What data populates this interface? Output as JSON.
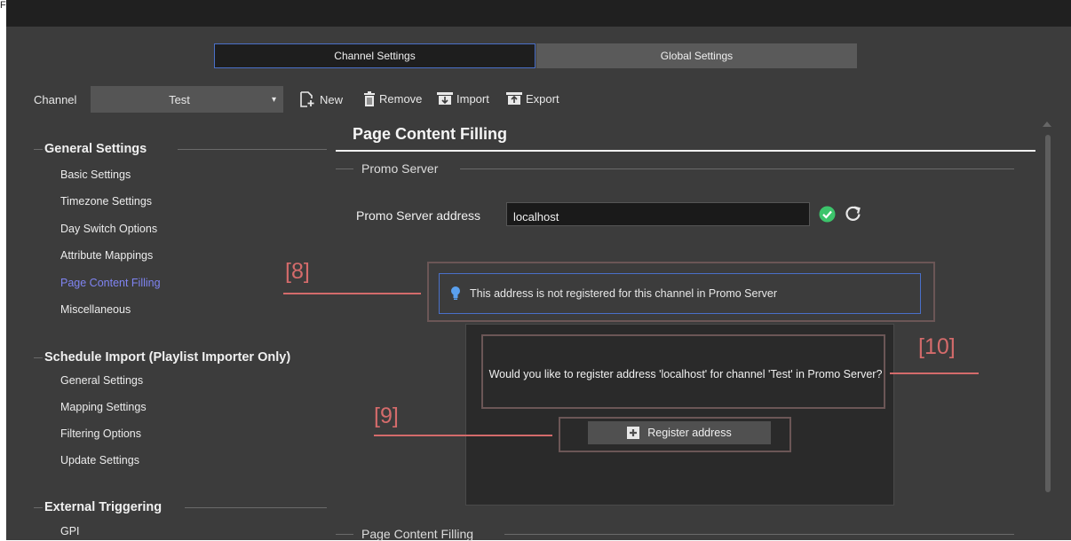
{
  "figure_label": "Fig",
  "tabs": [
    {
      "label": "Channel Settings",
      "active": true
    },
    {
      "label": "Global Settings",
      "active": false
    }
  ],
  "channel": {
    "label": "Channel",
    "value": "Test"
  },
  "toolbar": {
    "new": "New",
    "remove": "Remove",
    "import": "Import",
    "export": "Export"
  },
  "sidebar": {
    "groups": [
      {
        "title": "General Settings",
        "items": [
          "Basic Settings",
          "Timezone Settings",
          "Day Switch Options",
          "Attribute Mappings",
          "Page Content Filling",
          "Miscellaneous"
        ]
      },
      {
        "title": "Schedule Import (Playlist Importer Only)",
        "items": [
          "General Settings",
          "Mapping Settings",
          "Filtering Options",
          "Update Settings"
        ]
      },
      {
        "title": "External Triggering",
        "items": [
          "GPI"
        ]
      }
    ],
    "active_item": "Page Content Filling"
  },
  "main": {
    "title": "Page Content Filling",
    "section_promo": "Promo Server",
    "address_label": "Promo Server address",
    "address_value": "localhost",
    "info_message": "This address is not registered for this channel in Promo Server",
    "dialog_text": "Would you like to register address 'localhost' for channel 'Test' in Promo Server?",
    "register_button": "Register address",
    "section_page_content": "Page Content Filling"
  },
  "annotations": [
    "[8]",
    "[9]",
    "[10]"
  ],
  "colors": {
    "accent_blue": "#4a70c9",
    "active_nav": "#7f84f2",
    "annotation_red": "#d46b6b",
    "status_ok": "#3cc46b"
  }
}
